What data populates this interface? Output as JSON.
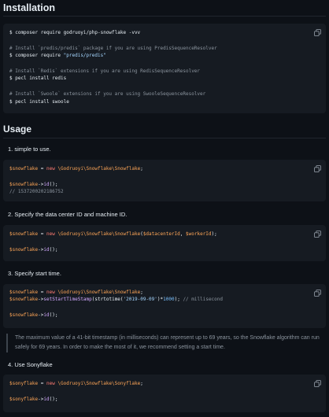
{
  "installation": {
    "title": "Installation",
    "code": {
      "l1": "$ composer require godruoyi/php-snowflake -vvv",
      "c1": "# Install `predis/predis` package if you are using PredisSequenceResolver",
      "l2a": "$ composer require ",
      "l2b": "\"predis/predis\"",
      "c2": "# Install `Redis` extensions if you are using RedisSequenceResolver",
      "l3": "$ pecl install redis",
      "c3": "# Install `Swoole` extensions if you are using SwooleSequenceResolver",
      "l4": "$ pecl install swoole"
    }
  },
  "usage": {
    "title": "Usage",
    "step1": {
      "label": "1. simple to use.",
      "var": "$snowflake",
      "eq": " = ",
      "new": "new",
      "cls": " \\Godruoyi\\Snowflake\\Snowflake",
      "end": ";",
      "call_var": "$snowflake",
      "arrow": "->",
      "fn": "id",
      "call_end": "();",
      "comment": "// 1537200202186752"
    },
    "step2": {
      "label": "2. Specify the data center ID and machine ID.",
      "var": "$snowflake",
      "eq": " = ",
      "new": "new",
      "cls": " \\Godruoyi\\Snowflake\\Snowflake",
      "open": "(",
      "arg1": "$datacenterId",
      "sep": ", ",
      "arg2": "$workerId",
      "close": ");",
      "call_var": "$snowflake",
      "arrow": "->",
      "fn": "id",
      "call_end": "();"
    },
    "step3": {
      "label": "3. Specify start time.",
      "var": "$snowflake",
      "eq": " = ",
      "new": "new",
      "cls": " \\Godruoyi\\Snowflake\\Snowflake",
      "end": ";",
      "var2": "$snowflake",
      "arrow": "->",
      "fn2": "setStartTimeStamp",
      "open": "(",
      "fn3": "strtotime",
      "paren": "(",
      "str": "'2019-09-09'",
      "close1": ")*",
      "num": "1000",
      "close2": "); ",
      "comment": "// millisecond",
      "call_var": "$snowflake",
      "fn": "id",
      "call_end": "();"
    },
    "note": "The maximum value of a 41-bit timestamp (in milliseconds) can represent up to 69 years, so the Snowflake algorithm can run safely for 69 years. In order to make the most of it, we recommend setting a start time.",
    "step4": {
      "label": "4. Use Sonyflake",
      "var": "$sonyflake",
      "eq": " = ",
      "new": "new",
      "cls": " \\Godruoyi\\Snowflake\\Sonyflake",
      "end": ";",
      "call_var": "$sonyflake",
      "arrow": "->",
      "fn": "id",
      "call_end": "();"
    }
  },
  "icons": {
    "copy": "copy-icon"
  },
  "colors": {
    "background": "#0d1117",
    "code_background": "#161b22",
    "comment": "#8b949e",
    "variable": "#ffa657",
    "keyword": "#ff7b72",
    "function": "#d2a8ff",
    "string": "#a5d6ff"
  }
}
